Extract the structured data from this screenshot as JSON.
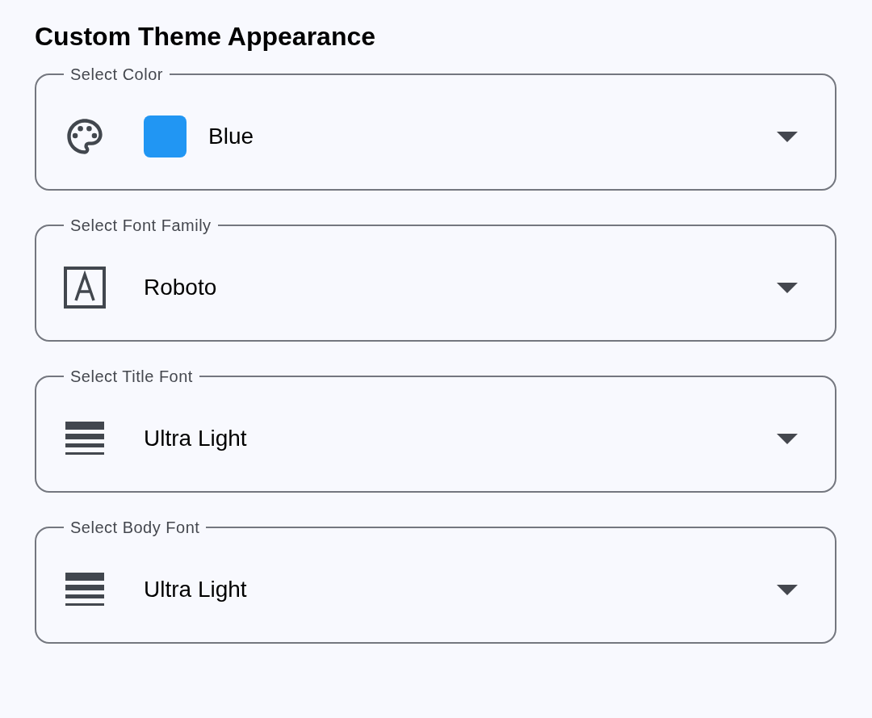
{
  "title": "Custom Theme Appearance",
  "fields": [
    {
      "label": "Select Color",
      "kind": "palette",
      "value": "Blue",
      "color": "#2196f3"
    },
    {
      "label": "Select Font Family",
      "kind": "font",
      "value": "Roboto"
    },
    {
      "label": "Select Title Font",
      "kind": "weight",
      "value": "Ultra Light"
    },
    {
      "label": "Select Body Font",
      "kind": "weight",
      "value": "Ultra Light"
    }
  ]
}
